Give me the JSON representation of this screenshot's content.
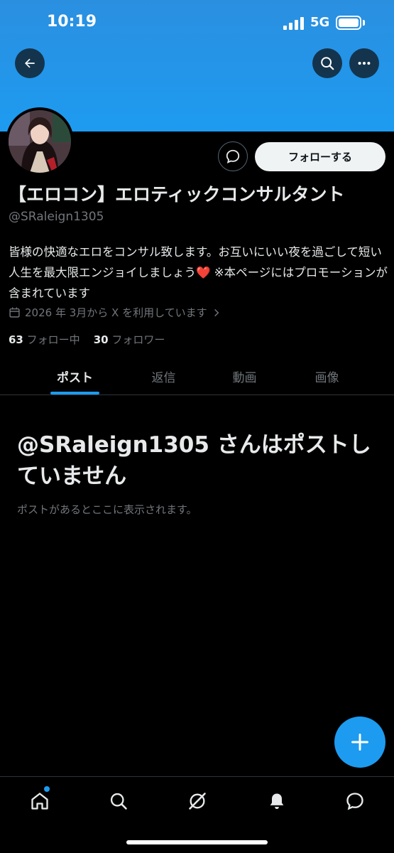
{
  "status_bar": {
    "time": "10:19",
    "network": "5G"
  },
  "header": {
    "back_icon": "arrow-left-icon",
    "search_icon": "search-icon",
    "more_icon": "more-horizontal-icon",
    "banner_color": "#1d9bf0"
  },
  "profile": {
    "display_name": "【エロコン】エロティックコンサルタント",
    "handle": "@SRaleign1305",
    "bio": "皆様の快適なエロをコンサル致します。お互いにいい夜を過ごして短い人生を最大限エンジョイしましょう❤️ ※本ページにはプロモーションが含まれています",
    "joined": "2026 年 3月から X を利用しています",
    "following_count": "63",
    "following_label": "フォロー中",
    "followers_count": "30",
    "followers_label": "フォロワー",
    "follow_button": "フォローする"
  },
  "tabs": [
    {
      "label": "ポスト",
      "active": true
    },
    {
      "label": "返信",
      "active": false
    },
    {
      "label": "動画",
      "active": false
    },
    {
      "label": "画像",
      "active": false
    }
  ],
  "empty_state": {
    "title": "@SRaleign1305 さんはポストしていません",
    "subtitle": "ポストがあるとここに表示されます。"
  },
  "bottom_nav": [
    "home-icon",
    "search-icon",
    "grok-icon",
    "notifications-icon",
    "messages-icon"
  ],
  "accent_color": "#1d9bf0"
}
